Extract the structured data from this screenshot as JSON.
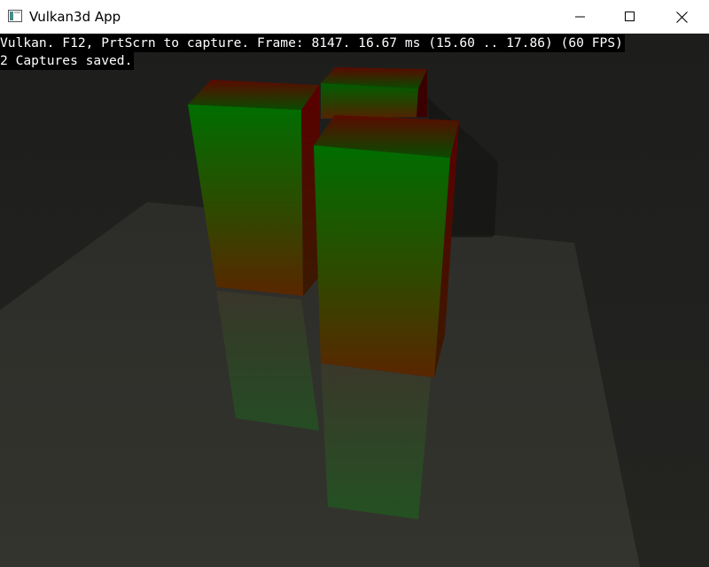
{
  "window": {
    "title": "Vulkan3d App",
    "controls": [
      "minimize",
      "maximize",
      "close"
    ]
  },
  "overlay": {
    "status_line": "Vulkan. F12, PrtScrn to capture. Frame: 8147. 16.67 ms (15.60 .. 17.86) (60 FPS)",
    "captures_line": "2 Captures saved."
  },
  "scene": {
    "description_colors": {
      "background": "#1b1b19",
      "floor": "#30302b",
      "box_top": "#007a00",
      "box_bottom": "#5c2800"
    }
  }
}
